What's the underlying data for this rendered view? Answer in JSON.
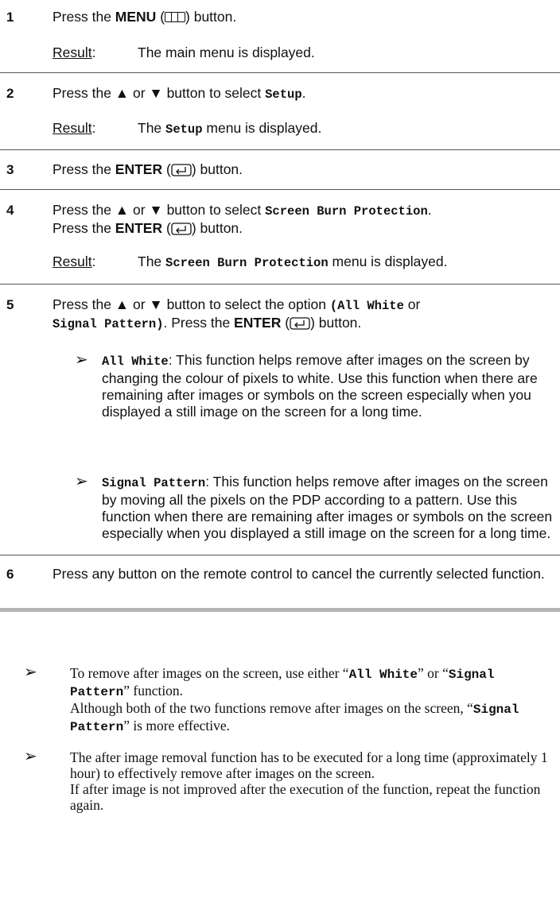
{
  "steps": [
    {
      "num": "1",
      "line1_pre": "Press the ",
      "line1_bold": "MENU",
      "line1_post_open": " (",
      "line1_post_close": ") button.",
      "result_label": "Result",
      "result_colon": ":",
      "result_text": "The main menu is displayed."
    },
    {
      "num": "2",
      "line1_pre": "Press the ▲ or ▼ button to select ",
      "line1_mono": "Setup",
      "line1_post": ".",
      "result_label": "Result",
      "result_colon": ":",
      "result_pre": "The ",
      "result_mono": "Setup",
      "result_post": " menu is displayed."
    },
    {
      "num": "3",
      "line1_pre": "Press the ",
      "line1_bold": "ENTER",
      "line1_open": " (",
      "line1_close": ") button."
    },
    {
      "num": "4",
      "line1_pre": "Press the ▲ or ▼ button to select ",
      "line1_mono": "Screen Burn Protection",
      "line1_post": ".",
      "line2_pre": "Press the ",
      "line2_bold": "ENTER",
      "line2_open": " (",
      "line2_close": ") button.",
      "result_label": "Result",
      "result_colon": ":",
      "result_pre": "The ",
      "result_mono": "Screen Burn Protection",
      "result_post": " menu is displayed."
    },
    {
      "num": "5",
      "line1_pre": "Press the ▲ or ▼ button to select the option ",
      "line1_mono": "(All White",
      "line1_post": " or",
      "line2_mono": "Signal Pattern)",
      "line2_pre": ". Press the ",
      "line2_bold": "ENTER",
      "line2_open": " (",
      "line2_close": ") button.",
      "notes": [
        {
          "arrow": "➢",
          "term": "All White",
          "text": ": This function helps remove after images on the screen by changing the colour of pixels to white. Use this function when there are remaining after images or symbols on the screen especially when you displayed a still image on the screen for a long time."
        },
        {
          "arrow": "➢",
          "term": "Signal Pattern",
          "text": ": This function helps remove after images on the screen by moving all the pixels on the PDP according to a pattern. Use this function when there are remaining after images or symbols on the screen especially when you displayed a still image on the screen for a long time."
        }
      ]
    },
    {
      "num": "6",
      "text": "Press any button on the remote control to cancel the currently selected function."
    }
  ],
  "footnotes": [
    {
      "arrow": "➢",
      "p1": "To remove after images on the screen, use either “",
      "m1": "All White",
      "p2": "” or “",
      "m2": "Signal Pattern",
      "p3": "” function.",
      "line2a": "Although both of the two functions remove after images on the screen, “",
      "m3": "Signal Pattern",
      "line2b": "” is more effective."
    },
    {
      "arrow": "➢",
      "text1": "The after image removal function has to be executed for a long time (approximately 1 hour) to effectively remove after images on the screen.",
      "text2": "If after image is not improved after the execution of the function, repeat the function again."
    }
  ]
}
